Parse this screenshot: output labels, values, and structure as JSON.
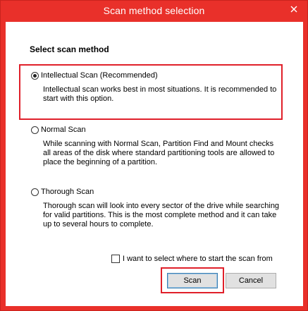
{
  "window": {
    "title": "Scan method selection",
    "close_icon": "close-icon"
  },
  "colors": {
    "titlebar": "#e9302a",
    "highlight": "#e0202a",
    "button_face": "#e1e1e1",
    "default_button_border": "#3c7fb1"
  },
  "heading": "Select scan method",
  "options": [
    {
      "label": "Intellectual Scan (Recommended)",
      "description": "Intellectual scan works best in most situations. It is recommended to start with this option.",
      "selected": true
    },
    {
      "label": "Normal Scan",
      "description": "While scanning with Normal Scan, Partition Find and Mount checks all areas of the disk where standard partitioning tools are allowed to place the beginning of a partition.",
      "selected": false
    },
    {
      "label": "Thorough Scan",
      "description": "Thorough scan will look into every sector of the drive while searching for valid partitions. This is the most complete method and it can take up to several hours to complete.",
      "selected": false
    }
  ],
  "start_location_checkbox": {
    "label": "I want to select where to start the scan from",
    "checked": false
  },
  "buttons": {
    "scan": "Scan",
    "cancel": "Cancel"
  }
}
